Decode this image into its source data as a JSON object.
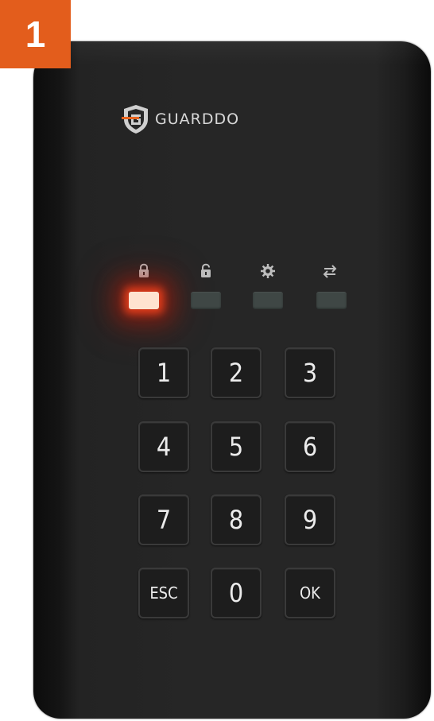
{
  "step": {
    "number": "1"
  },
  "brand": {
    "name": "GUARDDO"
  },
  "indicators": [
    {
      "icon": "lock-closed-icon",
      "state": "on",
      "color": "#ff3b1e"
    },
    {
      "icon": "lock-open-icon",
      "state": "off"
    },
    {
      "icon": "gear-icon",
      "state": "off"
    },
    {
      "icon": "swap-arrows-icon",
      "state": "off"
    }
  ],
  "keypad": {
    "k1": "1",
    "k2": "2",
    "k3": "3",
    "k4": "4",
    "k5": "5",
    "k6": "6",
    "k7": "7",
    "k8": "8",
    "k9": "9",
    "esc": "ESC",
    "k0": "0",
    "ok": "OK"
  },
  "colors": {
    "badge": "#e35d1c",
    "device": "#262626",
    "logo_accent": "#e8641e"
  }
}
